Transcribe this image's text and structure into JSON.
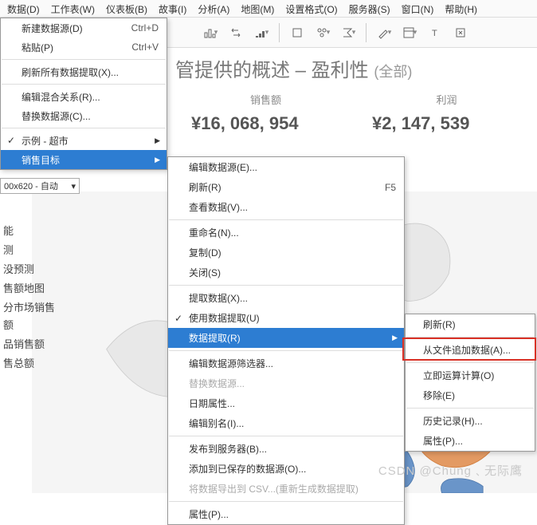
{
  "menubar": [
    "数据(D)",
    "工作表(W)",
    "仪表板(B)",
    "故事(I)",
    "分析(A)",
    "地图(M)",
    "设置格式(O)",
    "服务器(S)",
    "窗口(N)",
    "帮助(H)"
  ],
  "title_main": "管提供的概述 – 盈利性",
  "title_sub": "(全部)",
  "metrics": {
    "label1": "销售额",
    "label2": "利润",
    "val1": "¥16, 068, 954",
    "val2": "¥2, 147, 539"
  },
  "size_box": "00x620 - 自动",
  "left_items": [
    "能",
    "测",
    "没预测",
    "售额地图",
    "分市场销售额",
    "品销售额",
    "售总额"
  ],
  "menu1": [
    {
      "t": "新建数据源(D)",
      "sc": "Ctrl+D"
    },
    {
      "t": "粘贴(P)",
      "sc": "Ctrl+V"
    },
    {
      "hr": true
    },
    {
      "t": "刷新所有数据提取(X)..."
    },
    {
      "hr": true
    },
    {
      "t": "编辑混合关系(R)..."
    },
    {
      "t": "替换数据源(C)..."
    },
    {
      "hr": true
    },
    {
      "t": "示例 - 超市",
      "arrow": true,
      "check": true
    },
    {
      "t": "销售目标",
      "arrow": true,
      "sel": true
    }
  ],
  "menu2": [
    {
      "t": "编辑数据源(E)..."
    },
    {
      "t": "刷新(R)",
      "sc": "F5"
    },
    {
      "t": "查看数据(V)..."
    },
    {
      "hr": true
    },
    {
      "t": "重命名(N)..."
    },
    {
      "t": "复制(D)"
    },
    {
      "t": "关闭(S)"
    },
    {
      "hr": true
    },
    {
      "t": "提取数据(X)..."
    },
    {
      "t": "使用数据提取(U)",
      "check": true
    },
    {
      "t": "数据提取(R)",
      "arrow": true,
      "sel": true
    },
    {
      "hr": true
    },
    {
      "t": "编辑数据源筛选器..."
    },
    {
      "t": "替换数据源...",
      "dis": true
    },
    {
      "t": "日期属性..."
    },
    {
      "t": "编辑别名(I)..."
    },
    {
      "hr": true
    },
    {
      "t": "发布到服务器(B)..."
    },
    {
      "t": "添加到已保存的数据源(O)..."
    },
    {
      "t": "将数据导出到 CSV...(重新生成数据提取)",
      "dis": true
    },
    {
      "hr": true
    },
    {
      "t": "属性(P)..."
    }
  ],
  "menu3": [
    {
      "t": "刷新(R)"
    },
    {
      "hr": true
    },
    {
      "t": "从文件追加数据(A)...",
      "hl": true
    },
    {
      "hr": true
    },
    {
      "t": "立即运算计算(O)"
    },
    {
      "t": "移除(E)"
    },
    {
      "hr": true
    },
    {
      "t": "历史记录(H)..."
    },
    {
      "t": "属性(P)..."
    }
  ],
  "watermark": "CSDN @Chung﹑无际鹰"
}
